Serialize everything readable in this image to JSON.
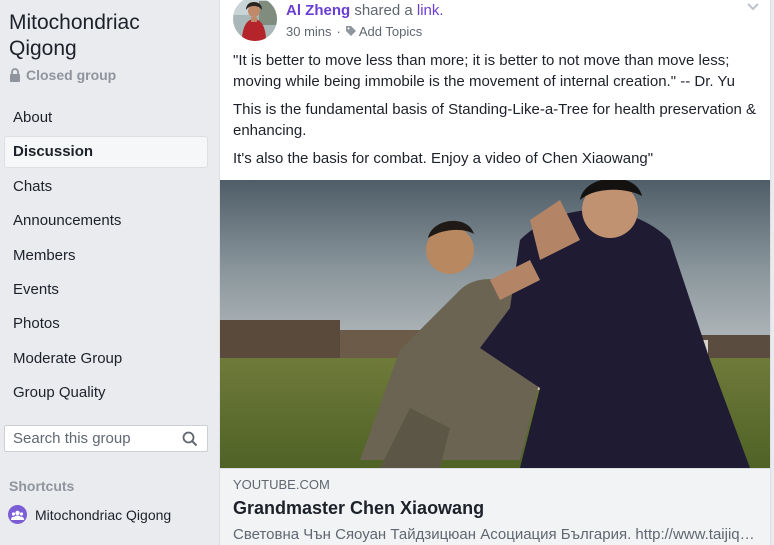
{
  "group": {
    "name": "Mitochondriac Qigong",
    "privacy": "Closed group",
    "lock_icon": "lock-icon"
  },
  "nav": {
    "items": [
      {
        "label": "About"
      },
      {
        "label": "Discussion",
        "active": true
      },
      {
        "label": "Chats"
      },
      {
        "label": "Announcements"
      },
      {
        "label": "Members"
      },
      {
        "label": "Events"
      },
      {
        "label": "Photos"
      },
      {
        "label": "Moderate Group"
      },
      {
        "label": "Group Quality"
      }
    ]
  },
  "search": {
    "placeholder": "Search this group",
    "icon": "search-icon"
  },
  "shortcuts": {
    "heading": "Shortcuts",
    "items": [
      {
        "label": "Mitochondriac Qigong",
        "icon": "group-icon"
      }
    ]
  },
  "post": {
    "author": "Al Zheng",
    "action_text": "shared a",
    "link_text": "link.",
    "time": "30 mins",
    "separator": "·",
    "add_topics": "Add Topics",
    "paragraphs": [
      "\"It is better to move less than more; it is better to not move than move less; moving while being immobile is the movement of internal creation.\" -- Dr. Yu",
      "This is the fundamental basis of Standing-Like-a-Tree for health preservation & enhancing.",
      "It's also the basis for combat. Enjoy a video of Chen Xiaowang\""
    ]
  },
  "link_preview": {
    "domain": "YOUTUBE.COM",
    "title": "Grandmaster Chen Xiaowang",
    "description": "Световна Чън Сяоуан Тайдзицюан Асоциация България. http://www.taijiquan.bg"
  },
  "colors": {
    "accent": "#6a3ed3",
    "background": "#e9ebee",
    "muted": "#90949c"
  }
}
